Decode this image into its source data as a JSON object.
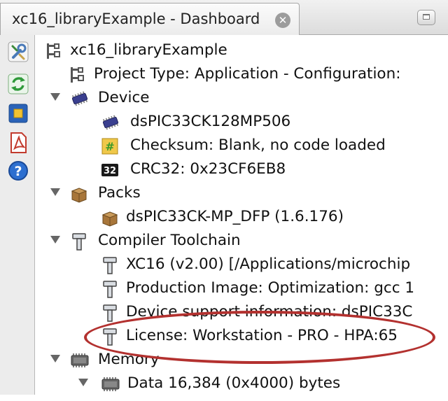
{
  "window": {
    "tab_title": "xc16_libraryExample - Dashboard",
    "close_icon": "close-circle-icon",
    "restore_icon": "restore-window-icon"
  },
  "toolbar": {
    "tools": [
      {
        "icon": "wrench-settings-icon"
      },
      {
        "icon": "refresh-icon"
      },
      {
        "icon": "chip-square-icon"
      },
      {
        "icon": "pdf-icon"
      },
      {
        "icon": "help-icon"
      }
    ]
  },
  "tree": {
    "project": {
      "label": "xc16_libraryExample",
      "icon": "project-icon"
    },
    "project_type": {
      "label": "Project Type: Application - Configuration:",
      "icon": "project-icon"
    },
    "device": {
      "label": "Device",
      "icon": "chip-icon"
    },
    "device_name": {
      "label": "dsPIC33CK128MP506",
      "icon": "chip-icon"
    },
    "checksum": {
      "label": "Checksum: Blank, no code loaded",
      "icon": "checksum-icon"
    },
    "crc": {
      "label": "CRC32: 0x23CF6EB8",
      "icon": "crc32-icon",
      "badge": "32"
    },
    "packs": {
      "label": "Packs",
      "icon": "package-icon"
    },
    "pack_item": {
      "label": "dsPIC33CK-MP_DFP (1.6.176)",
      "icon": "package-icon"
    },
    "compiler": {
      "label": "Compiler Toolchain",
      "icon": "hammer-icon"
    },
    "xc16": {
      "label": "XC16 (v2.00) [/Applications/microchip",
      "icon": "hammer-icon"
    },
    "production": {
      "label": "Production Image: Optimization: gcc 1",
      "icon": "hammer-icon"
    },
    "device_support": {
      "label": "Device support information: dsPIC33C",
      "icon": "hammer-icon"
    },
    "license": {
      "label": "License: Workstation - PRO -   HPA:65",
      "icon": "hammer-icon"
    },
    "memory": {
      "label": "Memory",
      "icon": "memory-icon"
    },
    "data": {
      "label": "Data 16,384 (0x4000) bytes",
      "icon": "memory-icon"
    }
  },
  "annotation": {
    "color": "#b3312f"
  }
}
